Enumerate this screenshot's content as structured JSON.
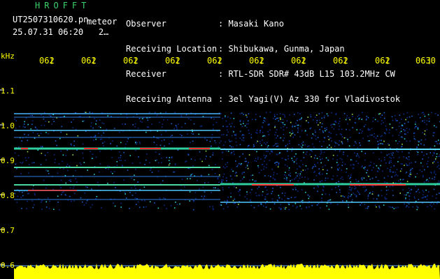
{
  "header": {
    "app_title": "HROFFT",
    "filename": "UT2507310620.pn",
    "mode_label": "meteor",
    "datetime": "25.07.31 06:20   2…"
  },
  "info": [
    {
      "label": "Observer",
      "value": ": Masaki Kano"
    },
    {
      "label": "Receiving Location",
      "value": ": Shibukawa, Gunma, Japan"
    },
    {
      "label": "Receiver",
      "value": ": RTL-SDR SDR# 43dB L15 103.2MHz CW"
    },
    {
      "label": "Receiving Antenna",
      "value": ": 3el Yagi(V) Az 330 for Vladivostok"
    }
  ],
  "axis": {
    "y_unit": "kHz",
    "y_ticks": [
      "1.1",
      "1.0",
      "0.9",
      "0.8",
      "0.7",
      "0.6"
    ],
    "x_ticks": [
      "062",
      "062",
      "062",
      "062",
      "062",
      "062",
      "062",
      "062",
      "062",
      "0630"
    ]
  },
  "colors": {
    "background": "#000000",
    "tick_text": "#ffff00",
    "title": "#39d36a",
    "noise_bar": "#ffff00"
  }
}
